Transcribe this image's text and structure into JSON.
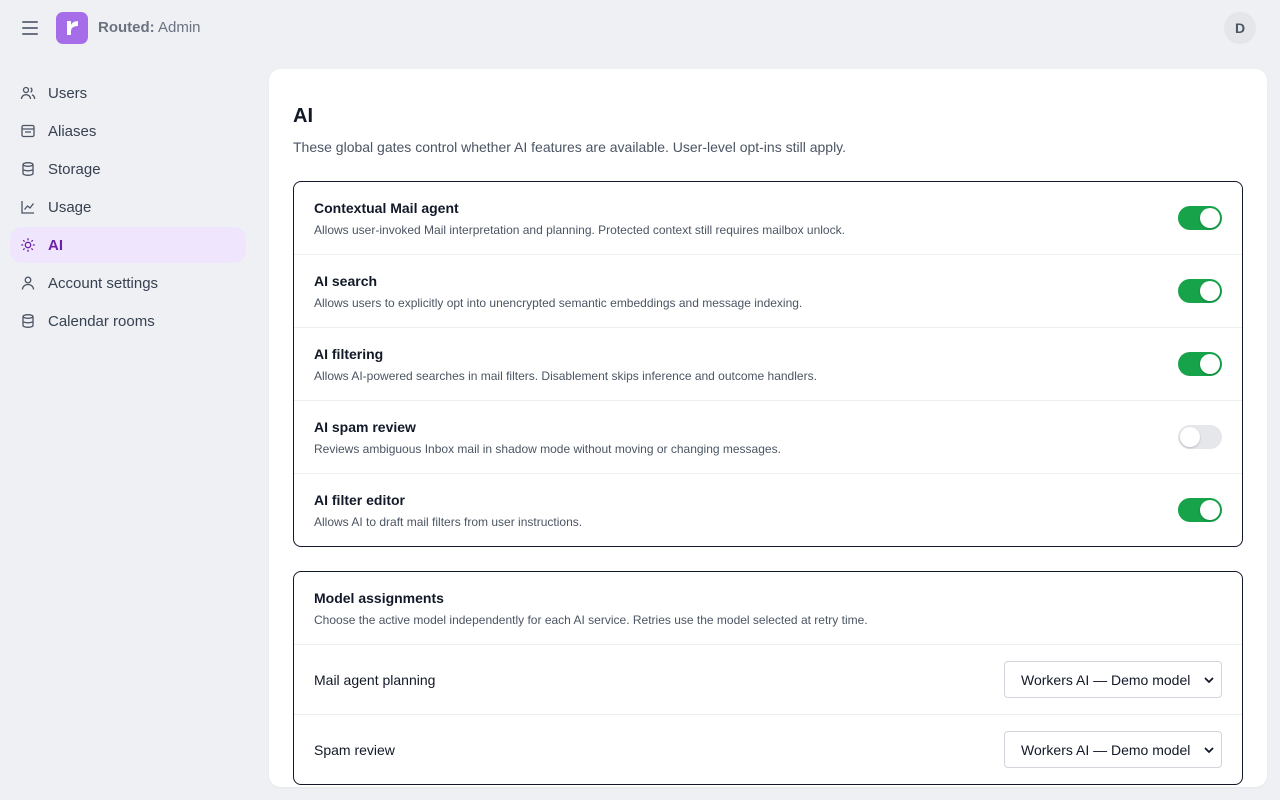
{
  "header": {
    "brand_bold": "Routed:",
    "brand_rest": " Admin",
    "avatar_initial": "D"
  },
  "sidebar": {
    "items": [
      {
        "label": "Users",
        "icon": "users-icon"
      },
      {
        "label": "Aliases",
        "icon": "inbox-icon"
      },
      {
        "label": "Storage",
        "icon": "database-icon"
      },
      {
        "label": "Usage",
        "icon": "chart-line-icon"
      },
      {
        "label": "AI",
        "icon": "sun-icon",
        "active": true
      },
      {
        "label": "Account settings",
        "icon": "user-icon"
      },
      {
        "label": "Calendar rooms",
        "icon": "database-icon"
      }
    ]
  },
  "main": {
    "title": "AI",
    "description": "These global gates control whether AI features are available. User-level opt-ins still apply.",
    "gates": [
      {
        "title": "Contextual Mail agent",
        "description": "Allows user-invoked Mail interpretation and planning. Protected context still requires mailbox unlock.",
        "enabled": true
      },
      {
        "title": "AI search",
        "description": "Allows users to explicitly opt into unencrypted semantic embeddings and message indexing.",
        "enabled": true
      },
      {
        "title": "AI filtering",
        "description": "Allows AI-powered searches in mail filters. Disablement skips inference and outcome handlers.",
        "enabled": true
      },
      {
        "title": "AI spam review",
        "description": "Reviews ambiguous Inbox mail in shadow mode without moving or changing messages.",
        "enabled": false
      },
      {
        "title": "AI filter editor",
        "description": "Allows AI to draft mail filters from user instructions.",
        "enabled": true
      }
    ],
    "models": {
      "title": "Model assignments",
      "description": "Choose the active model independently for each AI service. Retries use the model selected at retry time.",
      "rows": [
        {
          "label": "Mail agent planning",
          "selected": "Workers AI — Demo model"
        },
        {
          "label": "Spam review",
          "selected": "Workers AI — Demo model"
        }
      ]
    }
  },
  "colors": {
    "accent": "#6b21a8",
    "logo": "#a56ee8",
    "toggle_on": "#16a34a",
    "toggle_off": "#e5e7eb"
  }
}
